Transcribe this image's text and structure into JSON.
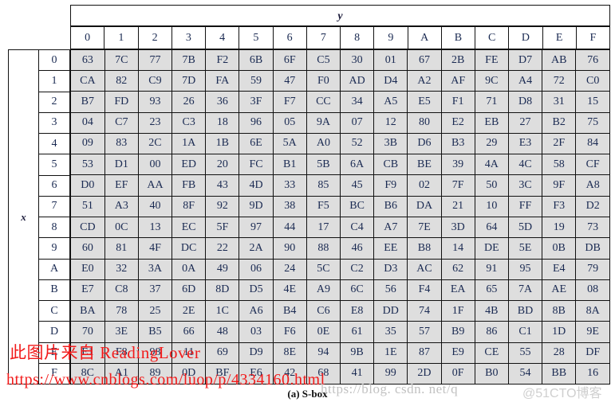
{
  "figure": {
    "caption": "(a) S-box",
    "axis_labels": {
      "columns": "y",
      "rows": "x"
    }
  },
  "colors": {
    "cell_background": "#dedede",
    "header_background": "#ffffff",
    "text": "#1a2a52",
    "border": "#111111",
    "watermark_red": "#f21a1a",
    "watermark_gray": "#c2c2c2"
  },
  "watermarks": {
    "red_line_1": "此图片来自 ReadingLover",
    "red_line_2": "https://www.cnblogs.com/luop/p/4334160.html",
    "gray_line_1": "https://blog. csdn. net/q",
    "gray_line_2": "@51CTO博客"
  },
  "chart_data": {
    "type": "table",
    "title": "(a) S-box",
    "xlabel": "y",
    "ylabel": "x",
    "columns": [
      "0",
      "1",
      "2",
      "3",
      "4",
      "5",
      "6",
      "7",
      "8",
      "9",
      "A",
      "B",
      "C",
      "D",
      "E",
      "F"
    ],
    "rows": [
      "0",
      "1",
      "2",
      "3",
      "4",
      "5",
      "6",
      "7",
      "8",
      "9",
      "A",
      "B",
      "C",
      "D",
      "E",
      "F"
    ],
    "values": [
      [
        "63",
        "7C",
        "77",
        "7B",
        "F2",
        "6B",
        "6F",
        "C5",
        "30",
        "01",
        "67",
        "2B",
        "FE",
        "D7",
        "AB",
        "76"
      ],
      [
        "CA",
        "82",
        "C9",
        "7D",
        "FA",
        "59",
        "47",
        "F0",
        "AD",
        "D4",
        "A2",
        "AF",
        "9C",
        "A4",
        "72",
        "C0"
      ],
      [
        "B7",
        "FD",
        "93",
        "26",
        "36",
        "3F",
        "F7",
        "CC",
        "34",
        "A5",
        "E5",
        "F1",
        "71",
        "D8",
        "31",
        "15"
      ],
      [
        "04",
        "C7",
        "23",
        "C3",
        "18",
        "96",
        "05",
        "9A",
        "07",
        "12",
        "80",
        "E2",
        "EB",
        "27",
        "B2",
        "75"
      ],
      [
        "09",
        "83",
        "2C",
        "1A",
        "1B",
        "6E",
        "5A",
        "A0",
        "52",
        "3B",
        "D6",
        "B3",
        "29",
        "E3",
        "2F",
        "84"
      ],
      [
        "53",
        "D1",
        "00",
        "ED",
        "20",
        "FC",
        "B1",
        "5B",
        "6A",
        "CB",
        "BE",
        "39",
        "4A",
        "4C",
        "58",
        "CF"
      ],
      [
        "D0",
        "EF",
        "AA",
        "FB",
        "43",
        "4D",
        "33",
        "85",
        "45",
        "F9",
        "02",
        "7F",
        "50",
        "3C",
        "9F",
        "A8"
      ],
      [
        "51",
        "A3",
        "40",
        "8F",
        "92",
        "9D",
        "38",
        "F5",
        "BC",
        "B6",
        "DA",
        "21",
        "10",
        "FF",
        "F3",
        "D2"
      ],
      [
        "CD",
        "0C",
        "13",
        "EC",
        "5F",
        "97",
        "44",
        "17",
        "C4",
        "A7",
        "7E",
        "3D",
        "64",
        "5D",
        "19",
        "73"
      ],
      [
        "60",
        "81",
        "4F",
        "DC",
        "22",
        "2A",
        "90",
        "88",
        "46",
        "EE",
        "B8",
        "14",
        "DE",
        "5E",
        "0B",
        "DB"
      ],
      [
        "E0",
        "32",
        "3A",
        "0A",
        "49",
        "06",
        "24",
        "5C",
        "C2",
        "D3",
        "AC",
        "62",
        "91",
        "95",
        "E4",
        "79"
      ],
      [
        "E7",
        "C8",
        "37",
        "6D",
        "8D",
        "D5",
        "4E",
        "A9",
        "6C",
        "56",
        "F4",
        "EA",
        "65",
        "7A",
        "AE",
        "08"
      ],
      [
        "BA",
        "78",
        "25",
        "2E",
        "1C",
        "A6",
        "B4",
        "C6",
        "E8",
        "DD",
        "74",
        "1F",
        "4B",
        "BD",
        "8B",
        "8A"
      ],
      [
        "70",
        "3E",
        "B5",
        "66",
        "48",
        "03",
        "F6",
        "0E",
        "61",
        "35",
        "57",
        "B9",
        "86",
        "C1",
        "1D",
        "9E"
      ],
      [
        "E1",
        "F8",
        "98",
        "11",
        "69",
        "D9",
        "8E",
        "94",
        "9B",
        "1E",
        "87",
        "E9",
        "CE",
        "55",
        "28",
        "DF"
      ],
      [
        "8C",
        "A1",
        "89",
        "0D",
        "BF",
        "E6",
        "42",
        "68",
        "41",
        "99",
        "2D",
        "0F",
        "B0",
        "54",
        "BB",
        "16"
      ]
    ]
  }
}
